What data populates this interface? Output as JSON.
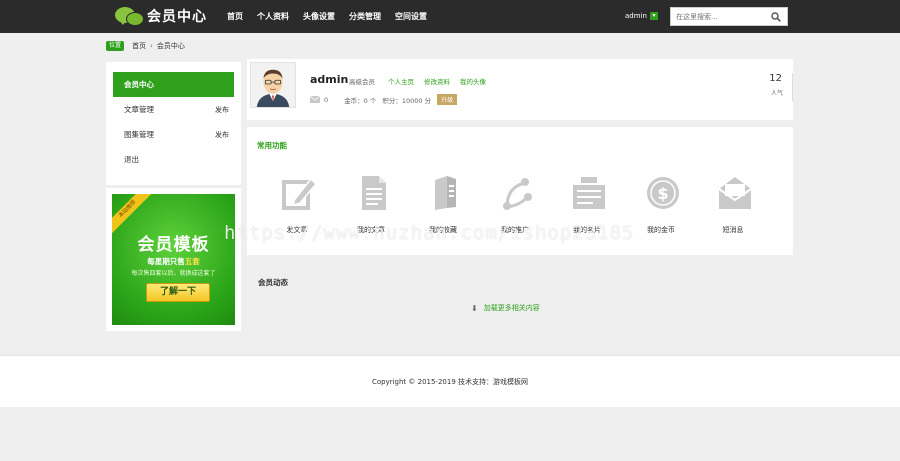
{
  "header": {
    "logo_text": "会员中心",
    "nav": [
      "首页",
      "个人资料",
      "头像设置",
      "分类管理",
      "空间设置"
    ],
    "user": "admin",
    "search_placeholder": "在这里搜索..."
  },
  "breadcrumb": {
    "badge": "位置",
    "home": "首页",
    "current": "会员中心"
  },
  "sidebar": {
    "items": [
      {
        "label": "会员中心",
        "extra": ""
      },
      {
        "label": "文章管理",
        "extra": "发布"
      },
      {
        "label": "图集管理",
        "extra": "发布"
      },
      {
        "label": "退出",
        "extra": ""
      }
    ]
  },
  "ad": {
    "ribbon": "本站推荐",
    "title": "会员模板",
    "line1_pre": "每星期只售",
    "line1_hl": "五套",
    "line2": "每次售四套以后，就换成这套了",
    "button": "了解一下"
  },
  "profile": {
    "username": "admin",
    "level": "高级会员",
    "links": [
      "个人主页",
      "修改资料",
      "我的头像"
    ],
    "messages": "0",
    "coins": "金币：0 个",
    "points": "积分：10000 分",
    "upgrade": "升级",
    "popularity": "12",
    "popularity_label": "人气"
  },
  "functions": {
    "title": "常用功能",
    "items": [
      {
        "label": "发文章",
        "icon": "edit-icon"
      },
      {
        "label": "我的文章",
        "icon": "document-icon"
      },
      {
        "label": "我的收藏",
        "icon": "book-icon"
      },
      {
        "label": "我的推广",
        "icon": "share-icon"
      },
      {
        "label": "我的名片",
        "icon": "card-icon"
      },
      {
        "label": "我的金币",
        "icon": "coin-icon"
      },
      {
        "label": "短消息",
        "icon": "mail-icon"
      }
    ]
  },
  "activity": {
    "title": "会员动态",
    "load_more": "加载更多相关内容"
  },
  "footer": {
    "text": "Copyright © 2015-2019 技术支持：游戏模板网"
  },
  "watermark": "https://www.huzhan.com/ishop23185",
  "colors": {
    "accent": "#2ea01c",
    "header_bg": "#2b2b2b",
    "page_bg": "#efefef"
  }
}
